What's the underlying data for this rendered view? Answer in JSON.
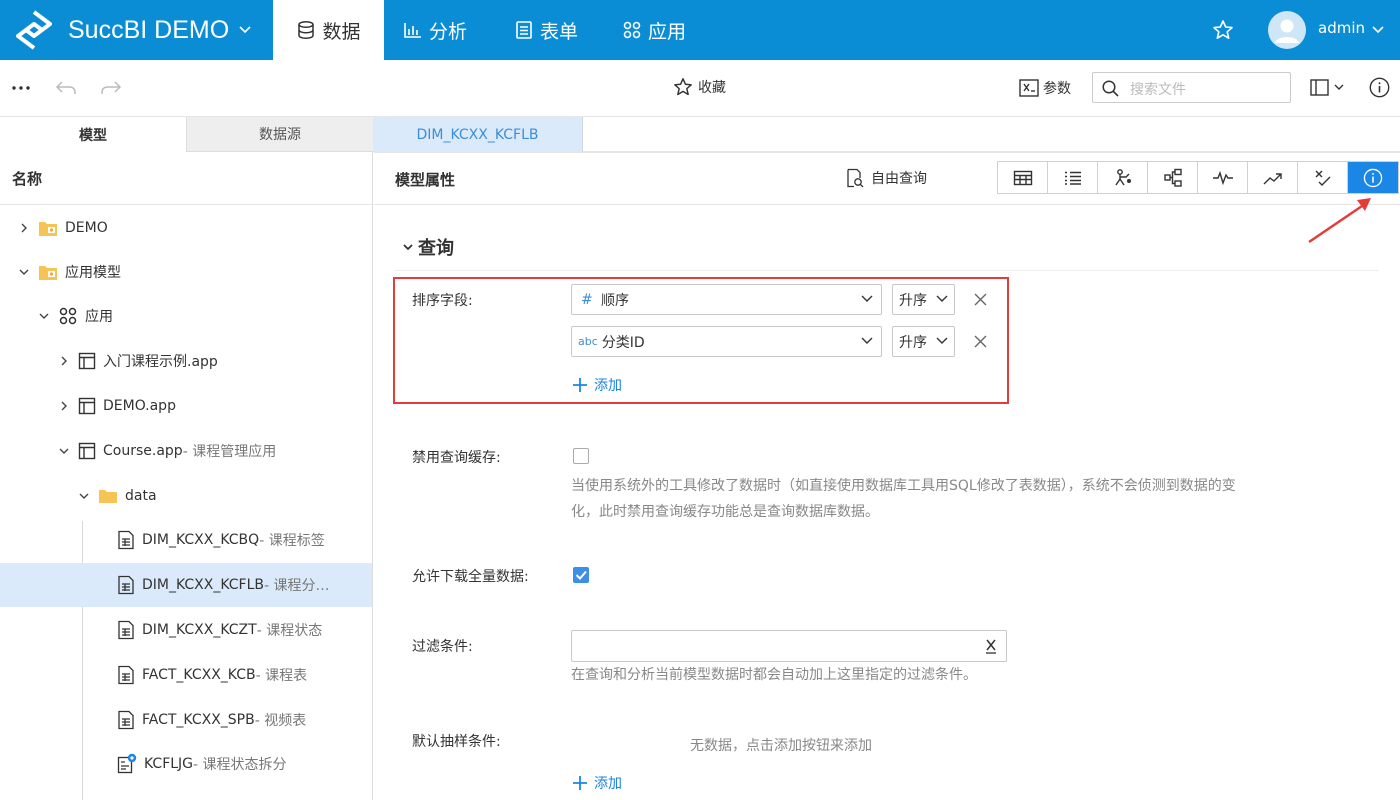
{
  "app": {
    "brand": "SuccBI DEMO",
    "user": "admin"
  },
  "nav": {
    "tabs": [
      {
        "label": "数据",
        "active": true
      },
      {
        "label": "分析",
        "active": false
      },
      {
        "label": "表单",
        "active": false
      },
      {
        "label": "应用",
        "active": false
      }
    ]
  },
  "toolbar": {
    "favorite": "收藏",
    "params": "参数",
    "search_placeholder": "搜索文件"
  },
  "left": {
    "tabs": [
      "模型",
      "数据源"
    ],
    "header": "名称",
    "tree": [
      {
        "label": "DEMO",
        "sub": "",
        "icon": "folder-app-icon"
      },
      {
        "label": "应用模型",
        "sub": "",
        "icon": "folder-app-icon"
      },
      {
        "label": "应用",
        "sub": "",
        "icon": "apps-icon"
      },
      {
        "label": "入门课程示例.app",
        "sub": "",
        "icon": "app-file-icon"
      },
      {
        "label": "DEMO.app",
        "sub": "",
        "icon": "app-file-icon"
      },
      {
        "label": "Course.app",
        "sub": " - 课程管理应用",
        "icon": "app-file-icon"
      },
      {
        "label": "data",
        "sub": "",
        "icon": "folder-icon"
      },
      {
        "label": "DIM_KCXX_KCBQ",
        "sub": " - 课程标签",
        "icon": "table-doc-icon"
      },
      {
        "label": "DIM_KCXX_KCFLB",
        "sub": " - 课程分…",
        "icon": "table-doc-icon",
        "selected": true
      },
      {
        "label": "DIM_KCXX_KCZT",
        "sub": " - 课程状态",
        "icon": "table-doc-icon"
      },
      {
        "label": "FACT_KCXX_KCB",
        "sub": " - 课程表",
        "icon": "table-doc-icon"
      },
      {
        "label": "FACT_KCXX_SPB",
        "sub": " - 视频表",
        "icon": "table-doc-icon"
      },
      {
        "label": "KCFLJG",
        "sub": " - 课程状态拆分",
        "icon": "etl-model-icon"
      }
    ]
  },
  "doc": {
    "tab": "DIM_KCXX_KCFLB",
    "header": "模型属性",
    "free_query": "自由查询",
    "section": "查询",
    "sort": {
      "label": "排序字段:",
      "rows": [
        {
          "type_icon": "#",
          "field": "顺序",
          "order": "升序"
        },
        {
          "type_icon": "abc",
          "field": "分类ID",
          "order": "升序"
        }
      ],
      "add": "添加"
    },
    "disable_cache": {
      "label": "禁用查询缓存:",
      "checked": false,
      "help_line1": "当使用系统外的工具修改了数据时（如直接使用数据库工具用SQL修改了表数据），系统不会侦测到数据的变",
      "help_line2": "化，此时禁用查询缓存功能总是查询数据库数据。"
    },
    "allow_download": {
      "label": "允许下载全量数据:",
      "checked": true
    },
    "filter": {
      "label": "过滤条件:",
      "value": "",
      "help": "在查询和分析当前模型数据时都会自动加上这里指定的过滤条件。"
    },
    "sampling": {
      "label": "默认抽样条件:",
      "empty": "无数据，点击添加按钮来添加",
      "add": "添加"
    }
  },
  "colors": {
    "brand": "#0b8dd6",
    "accent": "#1a86e6",
    "highlight": "#e43b3b",
    "selected_row": "#dbeafa"
  }
}
